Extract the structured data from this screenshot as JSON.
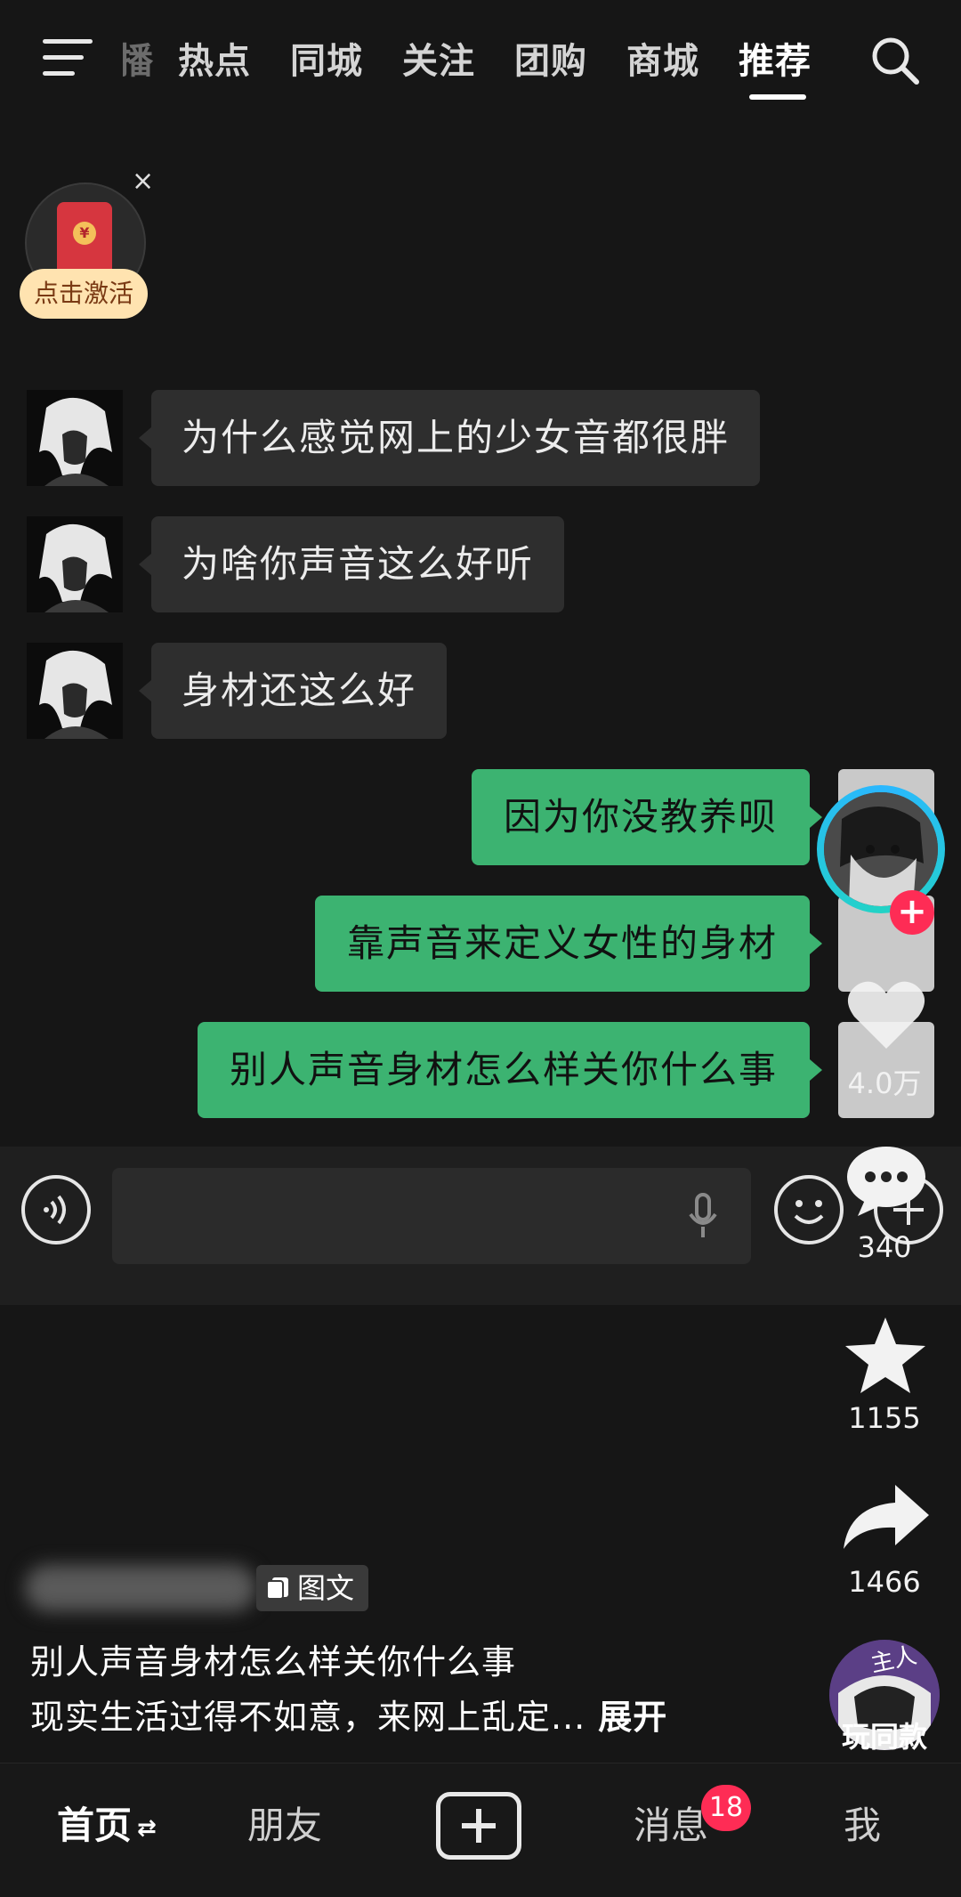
{
  "top_nav": {
    "tabs": [
      {
        "label": "播"
      },
      {
        "label": "热点"
      },
      {
        "label": "同城"
      },
      {
        "label": "关注"
      },
      {
        "label": "团购"
      },
      {
        "label": "商城"
      },
      {
        "label": "推荐"
      }
    ],
    "active_tab": "推荐"
  },
  "red_packet": {
    "badge_label": "点击激活",
    "close_glyph": "×",
    "coin_glyph": "¥"
  },
  "chat": {
    "received": [
      {
        "text": "为什么感觉网上的少女音都很胖"
      },
      {
        "text": "为啥你声音这么好听"
      },
      {
        "text": "身材还这么好"
      }
    ],
    "sent": [
      {
        "text": "因为你没教养呗"
      },
      {
        "text": "靠声音来定义女性的身材"
      },
      {
        "text": "别人声音身材怎么样关你什么事"
      }
    ],
    "input_placeholder": ""
  },
  "actions": {
    "like_count": "4.0万",
    "comment_count": "340",
    "favorite_count": "1155",
    "share_count": "1466",
    "play_same_label": "玩同款",
    "play_same_art_text": "主人",
    "follow_glyph": "+"
  },
  "caption": {
    "tag_label": "图文",
    "line1": "别人声音身材怎么样关你什么事",
    "line2": "现实生活过得不如意，来网上乱定...",
    "expand_label": "展开"
  },
  "bottom_nav": {
    "home": "首页",
    "home_refresh_glyph": "⇄",
    "friends": "朋友",
    "messages": "消息",
    "messages_badge": "18",
    "me": "我"
  },
  "colors": {
    "background": "#161616",
    "sent_bubble": "#3cb371",
    "received_bubble": "#2e2e2e",
    "accent_red": "#fe2c55"
  }
}
